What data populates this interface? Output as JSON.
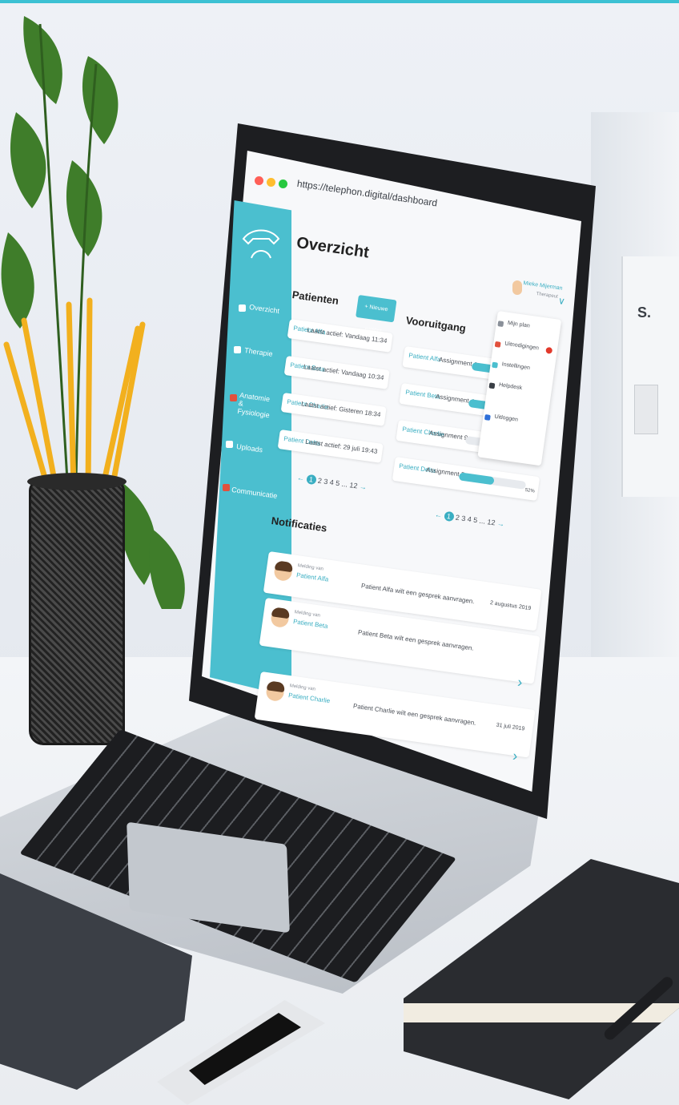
{
  "browser": {
    "url": "https://telephon.digital/dashboard"
  },
  "sidebar": {
    "items": [
      {
        "label": "Overzicht"
      },
      {
        "label": "Therapie"
      },
      {
        "label": "Anatomie & Fysiologie"
      },
      {
        "label": "Uploads"
      },
      {
        "label": "Communicatie"
      }
    ]
  },
  "page": {
    "title": "Overzicht"
  },
  "user": {
    "name": "Mieke Mijerman",
    "role": "Therapeut"
  },
  "user_menu": {
    "items": [
      {
        "label": "Mijn plan"
      },
      {
        "label": "Uitnodigingen"
      },
      {
        "label": "Instellingen"
      },
      {
        "label": "Helpdesk"
      },
      {
        "label": "Uitloggen"
      }
    ]
  },
  "patients": {
    "heading": "Patienten",
    "new_button": "+ Nieuwe patiënt",
    "rows": [
      {
        "name": "Patient Alfa",
        "last_active": "Laatst actief: Vandaag 11:34"
      },
      {
        "name": "Patient Beta",
        "last_active": "Laatst actief: Vandaag 10:34"
      },
      {
        "name": "Patient Charlie",
        "last_active": "Laatst actief: Gisteren 18:34"
      },
      {
        "name": "Patient Delta",
        "last_active": "Laatst actief: 29 juli 19:43"
      }
    ],
    "pager": {
      "prev": "←",
      "current": "1",
      "pages": "2 3 4 5 ... 12",
      "next": "→"
    }
  },
  "progress": {
    "heading": "Vooruitgang",
    "rows": [
      {
        "name": "Patient Alfa",
        "assignment": "Assignment 1",
        "fraction": 0.55,
        "percent": ""
      },
      {
        "name": "Patient Beta",
        "assignment": "Assignment 4",
        "fraction": 0.3,
        "percent": ""
      },
      {
        "name": "Patient Charlie",
        "assignment": "Assignment 9",
        "fraction": 0.0,
        "percent": "0%"
      },
      {
        "name": "Patient Delta",
        "assignment": "Assignment 5",
        "fraction": 0.52,
        "percent": "52%"
      }
    ],
    "pager": {
      "prev": "←",
      "current": "1",
      "pages": "2 3 4 5 ... 12",
      "next": "→"
    }
  },
  "notifications": {
    "heading": "Notificaties",
    "items": [
      {
        "small": "Melding van",
        "patient": "Patient Alfa",
        "message": "Patient Alfa wilt een gesprek aanvragen.",
        "date": "2 augustus 2019"
      },
      {
        "small": "Melding van",
        "patient": "Patient Beta",
        "message": "Patient Beta wilt een gesprek aanvragen.",
        "date": ""
      },
      {
        "small": "Melding van",
        "patient": "Patient Charlie",
        "message": "Patient Charlie wilt een gesprek aanvragen.",
        "date": "31 juli 2019"
      }
    ]
  },
  "colors": {
    "accent": "#4bbfcf",
    "accent_dark": "#3aaec2",
    "dot_red": "#ff5f57",
    "dot_yellow": "#ffbd2e",
    "dot_green": "#28c840"
  },
  "icons": {
    "logo": "telephone-icon",
    "chevron": "chevron-right-icon"
  }
}
